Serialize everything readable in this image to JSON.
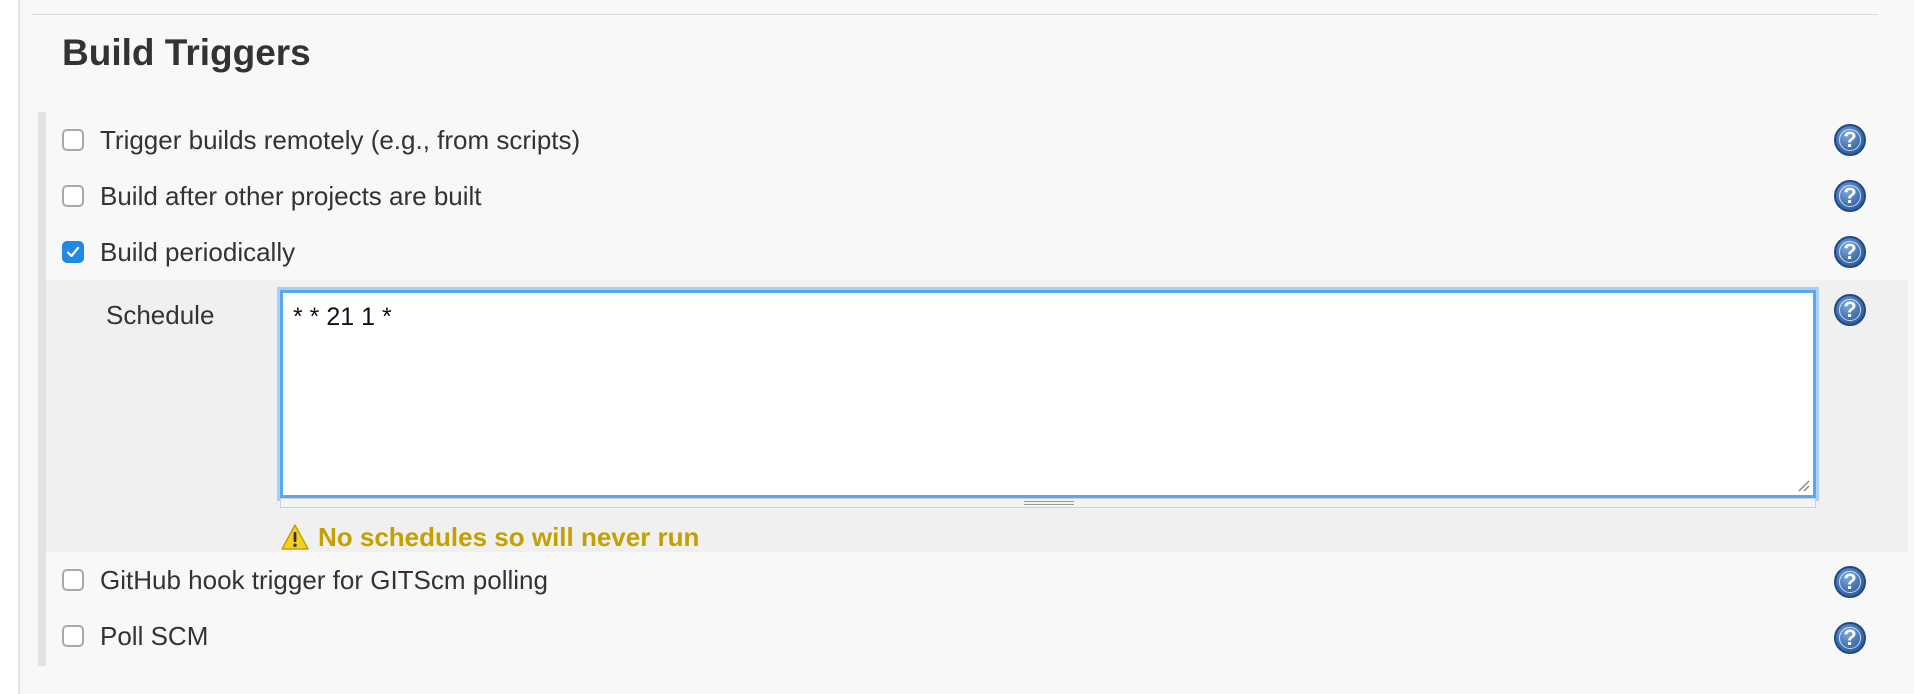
{
  "section": {
    "title": "Build Triggers"
  },
  "triggers": [
    {
      "label": "Trigger builds remotely (e.g., from scripts)",
      "checked": false
    },
    {
      "label": "Build after other projects are built",
      "checked": false
    },
    {
      "label": "Build periodically",
      "checked": true
    },
    {
      "label": "GitHub hook trigger for GITScm polling",
      "checked": false
    },
    {
      "label": "Poll SCM",
      "checked": false
    }
  ],
  "schedule": {
    "label": "Schedule",
    "value": "* * 21 1 *",
    "warning": "No schedules so will never run"
  },
  "help": {
    "glyph": "?"
  },
  "colors": {
    "accent": "#1e8ae6",
    "focus_border": "#5aa7ec",
    "warning_text": "#c4a000",
    "help_icon": "#3d6eb0"
  }
}
